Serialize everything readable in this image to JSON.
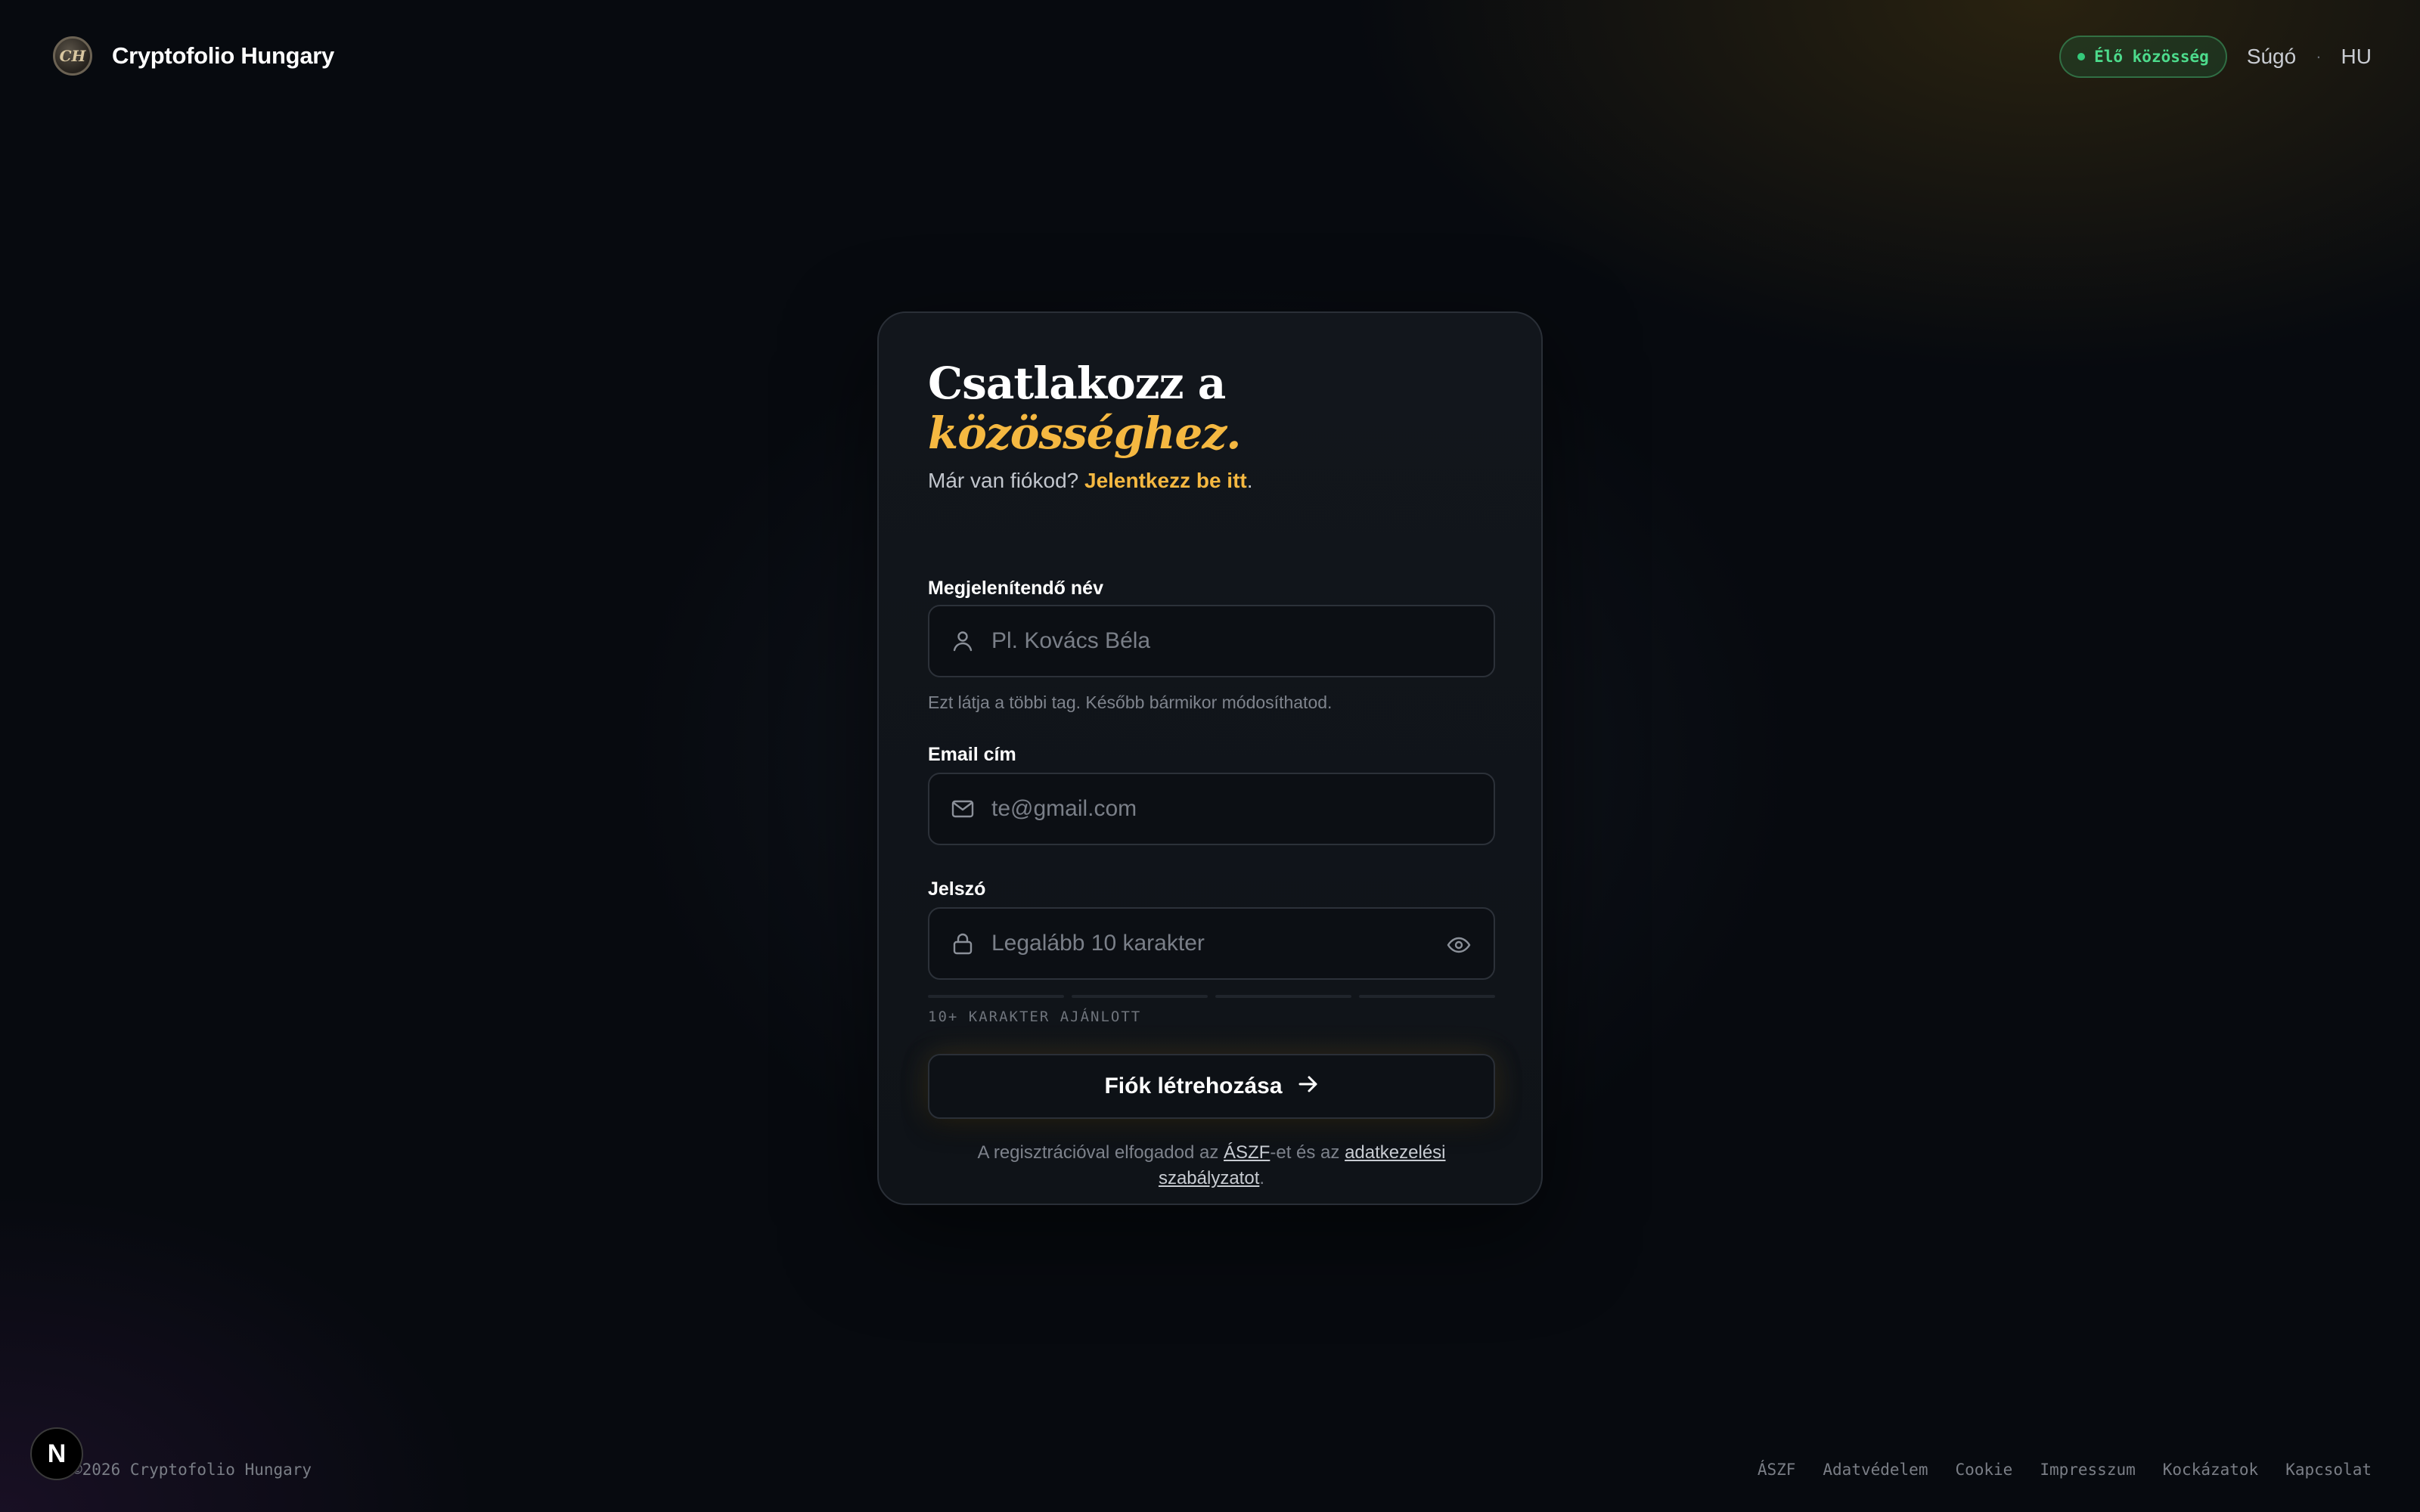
{
  "header": {
    "brand_logo_text": "CH",
    "brand_name": "Cryptofolio Hungary",
    "live_badge": "Élő közösség",
    "help_link": "Súgó",
    "separator": "·",
    "language": "HU"
  },
  "form": {
    "title_line1": "Csatlakozz a",
    "title_line2": "közösséghez.",
    "subtitle_text": "Már van fiókod?",
    "subtitle_link": "Jelentkezz be itt",
    "subtitle_end": ".",
    "name_label": "Megjelenítendő név",
    "name_placeholder": "Pl. Kovács Béla",
    "name_hint": "Ezt látja a többi tag. Később bármikor módosíthatod.",
    "email_label": "Email cím",
    "email_placeholder": "te@gmail.com",
    "password_label": "Jelszó",
    "password_placeholder": "Legalább 10 karakter",
    "password_hint": "10+ KARAKTER AJÁNLOTT",
    "submit_label": "Fiók létrehozása",
    "legal_prefix": "A regisztrációval elfogadod az",
    "legal_terms_link": "ÁSZF",
    "legal_middle": "-et és az",
    "legal_privacy_link": "adatkezelési szabályzatot",
    "legal_end": "."
  },
  "footer": {
    "copyright": "©2026 Cryptofolio Hungary",
    "n_badge": "N",
    "links": [
      "ÁSZF",
      "Adatvédelem",
      "Cookie",
      "Impresszum",
      "Kockázatok",
      "Kapcsolat"
    ]
  },
  "colors": {
    "accent": "#f5b841",
    "live_green": "#4ddb8c",
    "background": "#070a0f",
    "card": "#12161c"
  },
  "icons": {
    "name_field": "user-icon",
    "email_field": "mail-icon",
    "password_field": "lock-icon",
    "password_toggle": "eye-icon",
    "submit": "arrow-right-icon"
  }
}
